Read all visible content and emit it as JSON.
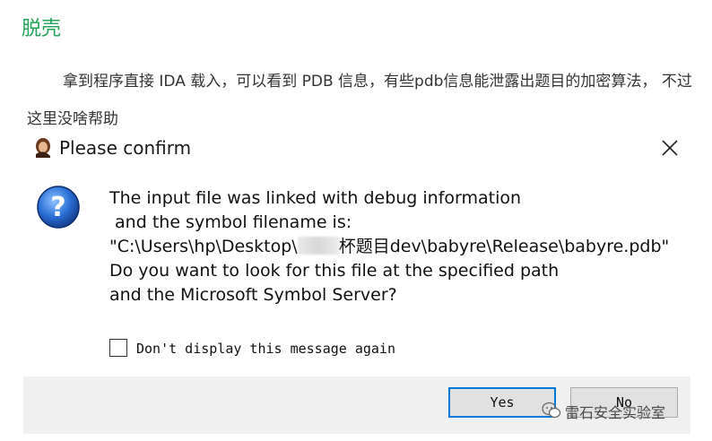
{
  "article": {
    "heading": "脱壳",
    "paragraph": "拿到程序直接 IDA 载入，可以看到 PDB 信息，有些pdb信息能泄露出题目的加密算法， 不过这里没啥帮助"
  },
  "dialog": {
    "title": "Please confirm",
    "message_lines": [
      "The input file was linked with debug information",
      " and the symbol filename is:",
      "\"C:\\Users\\hp\\Desktop\\",
      "杯题目dev\\babyre\\Release\\babyre.pdb\"",
      "Do you want to look for this file at the specified path",
      "and the Microsoft Symbol Server?"
    ],
    "checkbox_label": "Don't display this message again",
    "checkbox_checked": false,
    "yes_label": "Yes",
    "no_label": "No"
  },
  "watermark": {
    "text": "雷石安全实验室"
  },
  "colors": {
    "heading": "#23a35b",
    "default_button_border": "#0078d7",
    "footer": "#f0f0f0"
  }
}
